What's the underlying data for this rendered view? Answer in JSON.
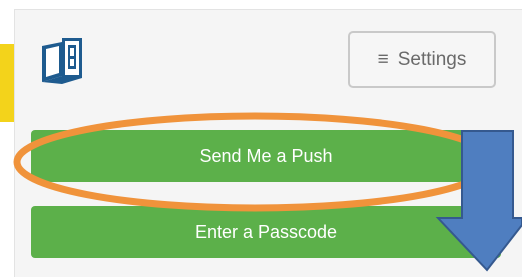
{
  "header": {
    "logo_icon": "book-app-logo-icon",
    "settings": {
      "icon": "hamburger-menu-icon",
      "icon_glyph": "≡",
      "label": "Settings"
    }
  },
  "actions": {
    "push_label": "Send Me a Push",
    "passcode_label": "Enter a Passcode"
  },
  "annotations": {
    "highlight_color": "#f0933b",
    "arrow_color": "#4f7ec0",
    "tab_color": "#f3d31b"
  },
  "colors": {
    "button_green": "#5cb04a",
    "logo_blue": "#1e5b8f"
  }
}
